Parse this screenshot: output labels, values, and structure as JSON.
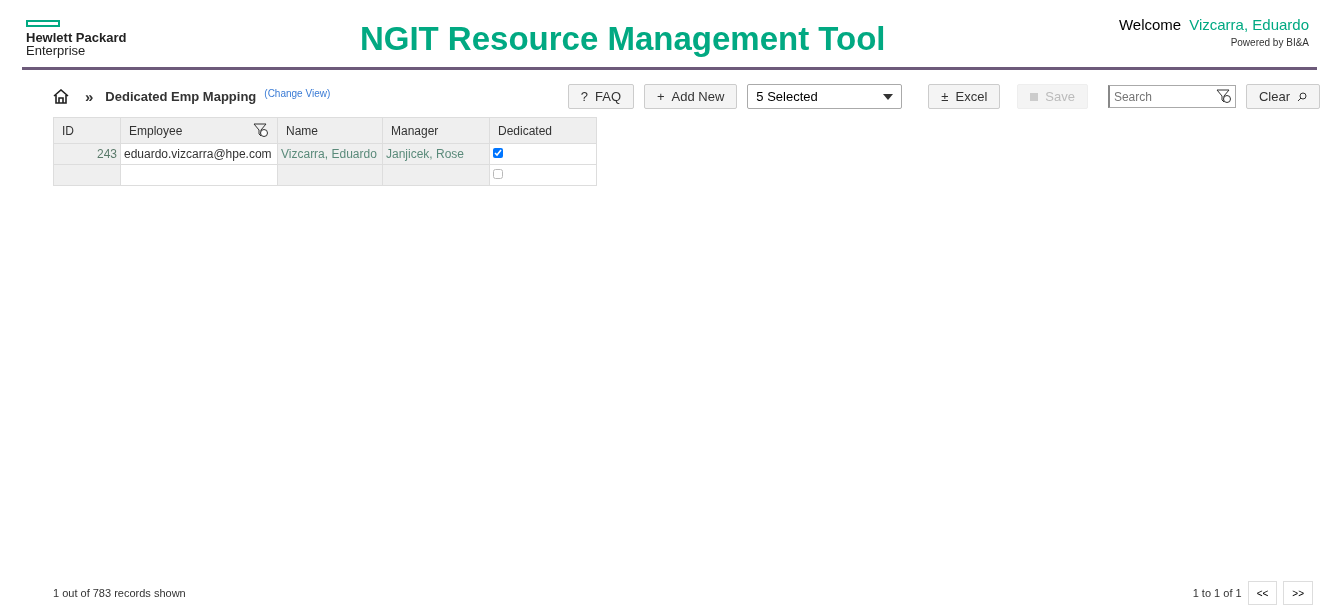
{
  "header": {
    "logo_line1": "Hewlett Packard",
    "logo_line2": "Enterprise",
    "title": "NGIT Resource Management Tool",
    "welcome": "Welcome",
    "user": "Vizcarra, Eduardo",
    "powered": "Powered by BI&A"
  },
  "breadcrumb": {
    "separator": "»",
    "page": "Dedicated Emp Mapping",
    "change_view": "(Change View)"
  },
  "toolbar": {
    "faq": {
      "icon": "?",
      "label": "FAQ",
      "disabled": false
    },
    "add": {
      "icon": "+",
      "label": "Add New",
      "disabled": false
    },
    "select": "5 Selected",
    "excel": {
      "icon": "±",
      "label": "Excel",
      "disabled": false
    },
    "save": {
      "label": "Save",
      "disabled": true
    },
    "search": {
      "placeholder": "Search"
    },
    "clear": "Clear"
  },
  "table": {
    "columns": [
      {
        "label": "ID",
        "filter": false
      },
      {
        "label": "Employee",
        "filter": true
      },
      {
        "label": "Name",
        "filter": false
      },
      {
        "label": "Manager",
        "filter": false
      },
      {
        "label": "Dedicated",
        "filter": false
      }
    ],
    "rows": [
      {
        "id": "243",
        "employee": "eduardo.vizcarra@hpe.com",
        "name": "Vizcarra, Eduardo",
        "manager": "Janjicek, Rose",
        "dedicated": true
      },
      {
        "dedicated": false
      }
    ]
  },
  "footer": {
    "records": "1 out of 783 records shown",
    "range": "1 to 1 of 1",
    "prev": "<<",
    "next": ">>"
  }
}
